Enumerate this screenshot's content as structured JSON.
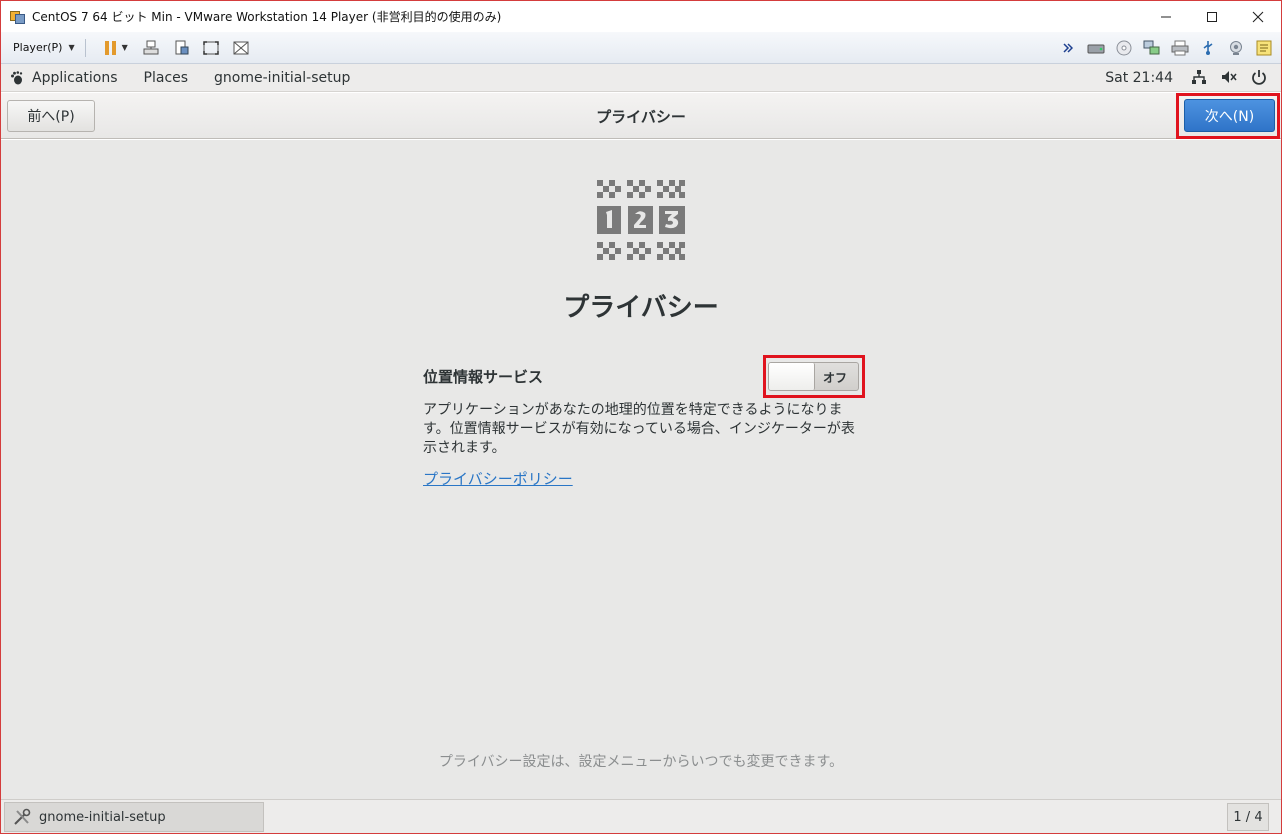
{
  "window": {
    "title": "CentOS 7 64 ビット Min - VMware Workstation 14 Player (非営利目的の使用のみ)",
    "minimize_icon": "minimize-icon",
    "maximize_icon": "maximize-icon",
    "close_icon": "close-icon"
  },
  "vmware_toolbar": {
    "player_menu": "Player(P)",
    "icons": [
      "pause-icon",
      "send-ctrl-alt-del-icon",
      "removable-devices-icon",
      "fullscreen-icon",
      "unity-icon"
    ],
    "device_icons": [
      "expand-icon",
      "hard-disk-icon",
      "cd-dvd-icon",
      "network-adapter-icon",
      "printer-icon",
      "usb-icon",
      "sound-icon",
      "message-log-icon"
    ]
  },
  "gnome_bar": {
    "applications": "Applications",
    "places": "Places",
    "app_name": "gnome-initial-setup",
    "clock": "Sat 21:44"
  },
  "header": {
    "prev_label": "前へ(P)",
    "title": "プライバシー",
    "next_label": "次へ(N)"
  },
  "content": {
    "heading": "プライバシー",
    "location_label": "位置情報サービス",
    "switch_state": "オフ",
    "switch_on": false,
    "description": "アプリケーションがあなたの地理的位置を特定できるようになります。位置情報サービスが有効になっている場合、インジケーターが表示されます。",
    "policy_link": "プライバシーポリシー",
    "footer_note": "プライバシー設定は、設定メニューからいつでも変更できます。"
  },
  "taskbar": {
    "item_label": "gnome-initial-setup",
    "pager": "1 / 4"
  },
  "colors": {
    "accent": "#3584e4",
    "highlight_frame": "#e0131e",
    "link": "#2a76c6"
  }
}
